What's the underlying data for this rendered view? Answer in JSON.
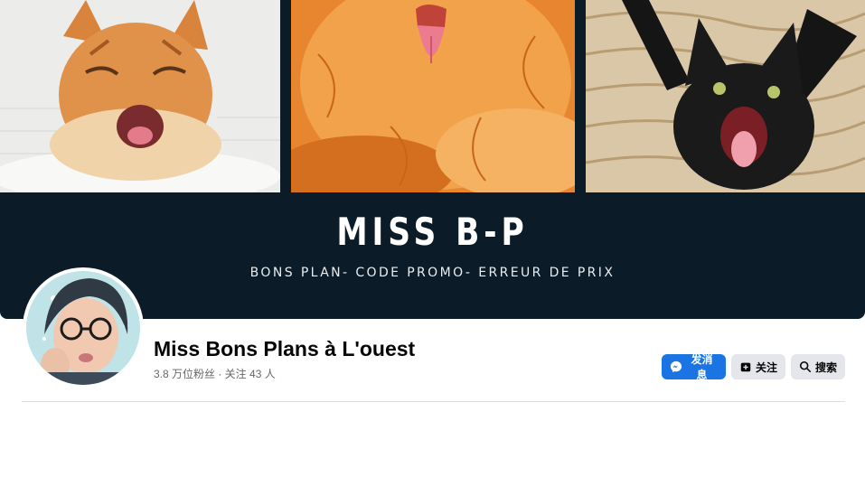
{
  "cover": {
    "title": "MISS B-P",
    "subtitle": "BONS PLAN- CODE PROMO- ERREUR DE PRIX",
    "background_color": "#0b1c28",
    "photos": [
      "orange-tabby-cat-yawning",
      "fluffy-orange-cat-tongue",
      "black-kitten-hissing"
    ]
  },
  "profile": {
    "avatar": "profile-photo-woman-glasses",
    "name": "Miss Bons Plans à L'ouest",
    "stats": "3.8 万位粉丝 · 关注 43 人"
  },
  "actions": {
    "message_label": "发消息",
    "message_icon": "messenger-icon",
    "follow_label": "关注",
    "follow_icon": "follow-icon",
    "search_label": "搜索",
    "search_icon": "search-icon",
    "primary_color": "#1b74e4",
    "secondary_color": "#e4e6eb"
  }
}
